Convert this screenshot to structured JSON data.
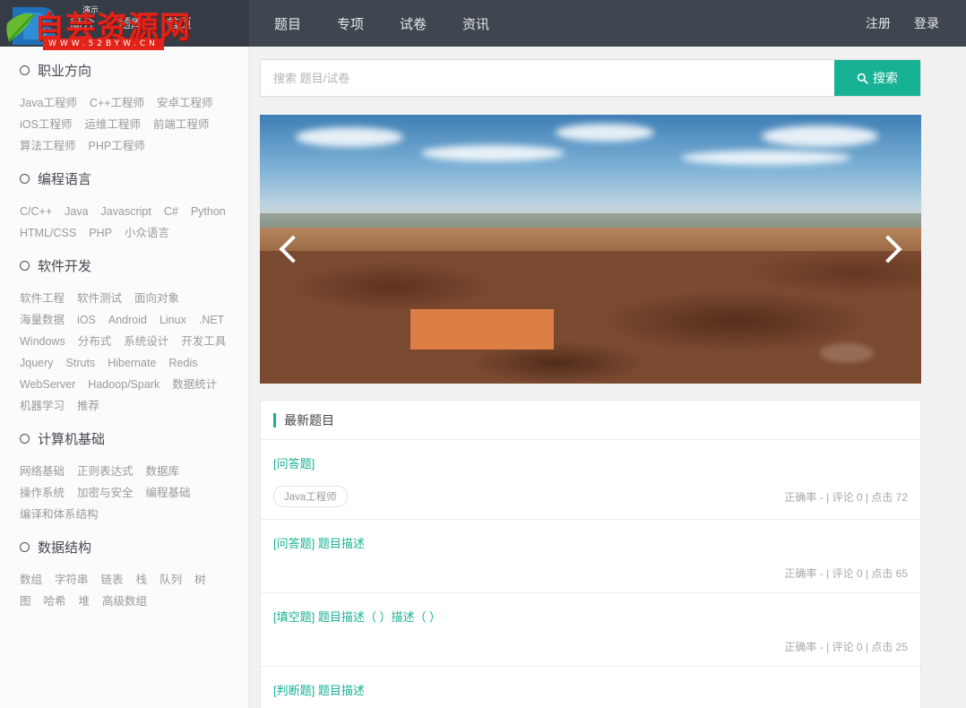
{
  "nav": {
    "brand_links": [
      {
        "label": "简介"
      },
      {
        "label": "题库"
      },
      {
        "label": "首页"
      }
    ],
    "demo_badge": "演示",
    "main_links": [
      {
        "label": "题目"
      },
      {
        "label": "专项"
      },
      {
        "label": "试卷"
      },
      {
        "label": "资讯"
      }
    ],
    "register": "注册",
    "login": "登录"
  },
  "watermark": {
    "text": "自芸资源网",
    "url": "WWW.52BYW.CN",
    "color": "#e2231a"
  },
  "search": {
    "placeholder": "搜索 题目/试卷",
    "value": "",
    "button_label": "搜索",
    "button_color": "#17b295"
  },
  "sidebar": {
    "sections": [
      {
        "title": "职业方向",
        "tags": [
          "Java工程师",
          "C++工程师",
          "安卓工程师",
          "iOS工程师",
          "运维工程师",
          "前端工程师",
          "算法工程师",
          "PHP工程师"
        ]
      },
      {
        "title": "编程语言",
        "tags": [
          "C/C++",
          "Java",
          "Javascript",
          "C#",
          "Python",
          "HTML/CSS",
          "PHP",
          "小众语言"
        ]
      },
      {
        "title": "软件开发",
        "tags": [
          "软件工程",
          "软件测试",
          "面向对象",
          "海量数据",
          "iOS",
          "Android",
          "Linux",
          ".NET",
          "Windows",
          "分布式",
          "系统设计",
          "开发工具",
          "Jquery",
          "Struts",
          "Hibernate",
          "Redis",
          "WebServer",
          "Hadoop/Spark",
          "数据统计",
          "机器学习",
          "推荐"
        ]
      },
      {
        "title": "计算机基础",
        "tags": [
          "网络基础",
          "正则表达式",
          "数据库",
          "操作系统",
          "加密与安全",
          "编程基础",
          "编译和体系结构"
        ]
      },
      {
        "title": "数据结构",
        "tags": [
          "数组",
          "字符串",
          "链表",
          "栈",
          "队列",
          "树",
          "图",
          "哈希",
          "堆",
          "高级数组"
        ]
      }
    ]
  },
  "carousel": {
    "prev_label": "上一张",
    "next_label": "下一张"
  },
  "latest": {
    "title": "最新题目",
    "items": [
      {
        "title": "[问答题]",
        "chip": "Java工程师",
        "stats": "正确率 - | 评论 0 | 点击 72"
      },
      {
        "title": "[问答题] 题目描述",
        "chip": "",
        "stats": "正确率 - | 评论 0 | 点击 65"
      },
      {
        "title": "[填空题] 题目描述（  ）描述（  ）",
        "chip": "",
        "stats": "正确率 - | 评论 0 | 点击 25"
      },
      {
        "title": "[判断题] 题目描述",
        "chip": "",
        "stats": ""
      }
    ]
  }
}
